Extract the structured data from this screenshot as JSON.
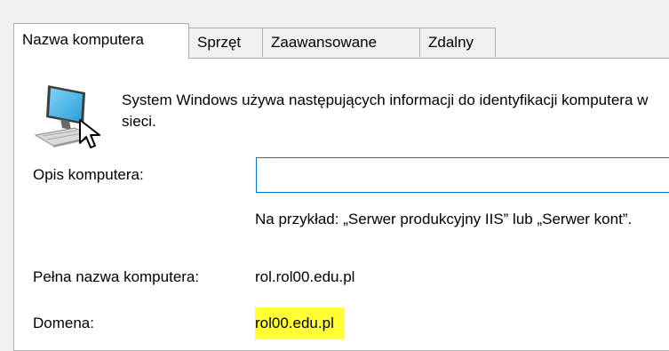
{
  "tabs": [
    {
      "label": "Nazwa komputera",
      "active": true
    },
    {
      "label": "Sprzęt",
      "active": false
    },
    {
      "label": "Zaawansowane",
      "active": false
    },
    {
      "label": "Zdalny",
      "active": false
    }
  ],
  "intro_text": "System Windows używa następujących informacji do identyfikacji komputera w sieci.",
  "description": {
    "label": "Opis komputera:",
    "value": "",
    "example": "Na przykład: „Serwer produkcyjny IIS” lub „Serwer kont”."
  },
  "full_name": {
    "label": "Pełna nazwa komputera:",
    "value": "rol.rol00.edu.pl"
  },
  "domain": {
    "label": "Domena:",
    "value": "rol00.edu.pl",
    "highlight_color": "#ffff33"
  },
  "icons": {
    "computer": "computer-network-icon",
    "cursor": "mouse-pointer-icon"
  },
  "colors": {
    "background": "#f0f0f0",
    "panel": "#ffffff",
    "border": "#adadad",
    "focus": "#0078d7"
  }
}
